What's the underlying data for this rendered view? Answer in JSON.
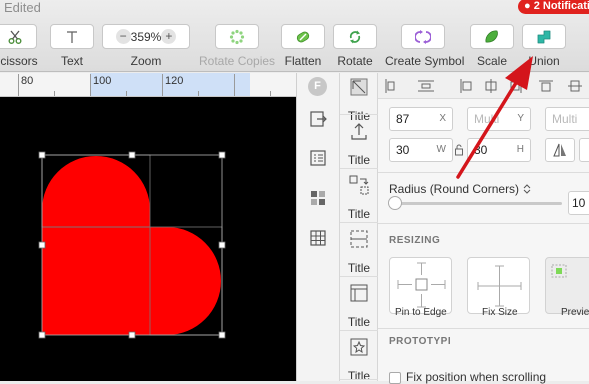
{
  "window": {
    "title": "Edited",
    "notification": "● 2 Notificati"
  },
  "toolbar": {
    "scissors": {
      "label": "Scissors",
      "icon": "scissors-icon"
    },
    "text": {
      "label": "Text",
      "icon": "text-icon"
    },
    "zoom": {
      "label": "Zoom",
      "value": "359%",
      "minus": "−",
      "plus": "+"
    },
    "rotate_copies": {
      "label": "Rotate Copies",
      "icon": "rotate-copies-icon"
    },
    "flatten": {
      "label": "Flatten",
      "icon": "flatten-icon"
    },
    "rotate": {
      "label": "Rotate",
      "icon": "rotate-icon"
    },
    "create_symbol": {
      "label": "Create Symbol",
      "icon": "create-symbol-icon"
    },
    "scale": {
      "label": "Scale",
      "icon": "scale-icon"
    },
    "union": {
      "label": "Union",
      "icon": "union-icon"
    }
  },
  "ruler": {
    "labels": [
      "80",
      "100",
      "120"
    ]
  },
  "side_strip": {
    "badge": "F"
  },
  "layer_titles": {
    "items": [
      "Title",
      "Title",
      "Title",
      "Title",
      "Title",
      "Title",
      "Title"
    ]
  },
  "inspector": {
    "x_value": "87",
    "x_suffix": "X",
    "y_placeholder": "Multi",
    "y_suffix": "Y",
    "extra_placeholder": "Multi",
    "w_value": "30",
    "w_suffix": "W",
    "h_value": "30",
    "h_suffix": "H",
    "radius_label": "Radius (Round Corners)",
    "radius_value": "10",
    "resizing_title": "RESIZING",
    "pin_label": "Pin to Edge",
    "fix_label": "Fix Size",
    "preview_label": "Preview",
    "prototype_title": "PROTOTYPI",
    "fix_scroll_label": "Fix position when scrolling"
  },
  "colors": {
    "heart": "#ff0000",
    "canvas": "#000000",
    "accent_green": "#4cae3c",
    "accent_teal": "#2db7a6",
    "arrow": "#d4151b"
  }
}
